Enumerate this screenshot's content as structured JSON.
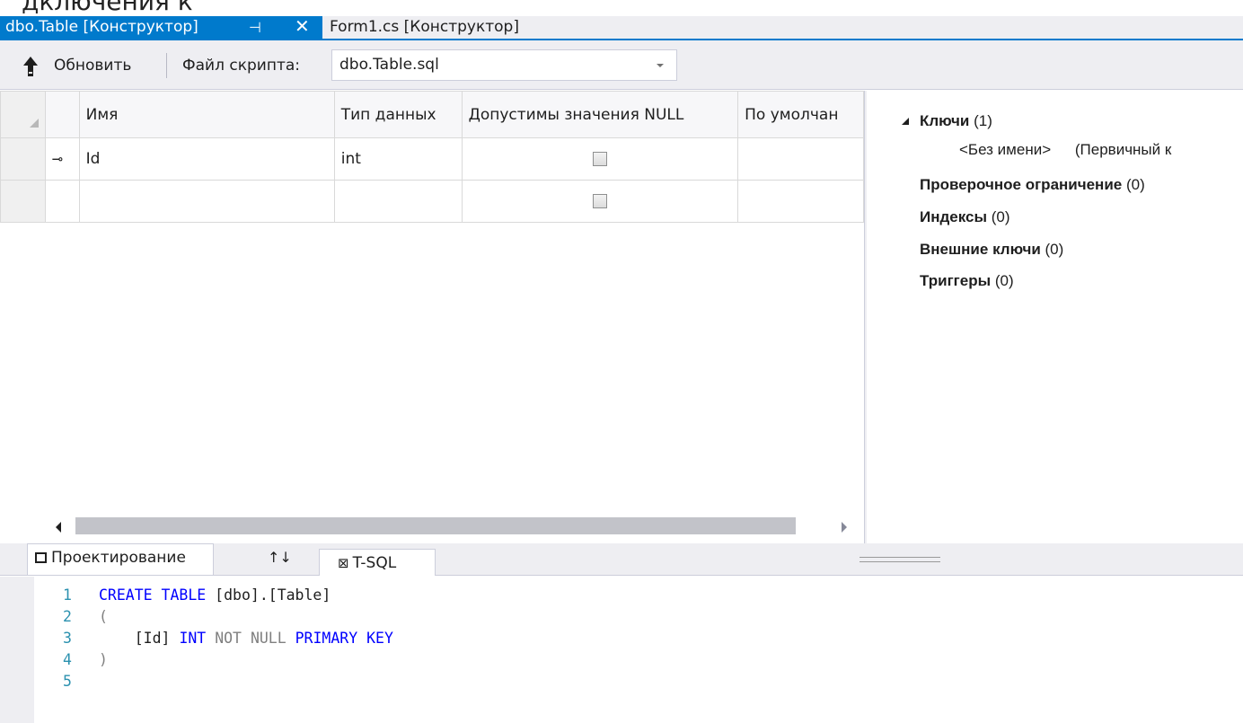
{
  "window": {
    "top_strip_text": "дключения к"
  },
  "tabs": [
    {
      "label": "dbo.Table [Конструктор]",
      "pin": "⊣",
      "close": "✕",
      "active": true
    },
    {
      "label": "Form1.cs [Конструктор]",
      "active": false
    }
  ],
  "toolbar": {
    "refresh_label": "Обновить",
    "script_label": "Файл скрипта:",
    "script_file": "dbo.Table.sql"
  },
  "grid": {
    "columns": [
      "Имя",
      "Тип данных",
      "Допустимы значения NULL",
      "По умолчан"
    ],
    "rows": [
      {
        "key": true,
        "name": "Id",
        "type": "int",
        "nullable": false,
        "default": ""
      },
      {
        "key": false,
        "name": "",
        "type": "",
        "nullable": false,
        "default": ""
      }
    ]
  },
  "properties": {
    "keys": {
      "label": "Ключи",
      "count": "(1)"
    },
    "key_item": {
      "name": "<Без имени>",
      "kind": "(Первичный к"
    },
    "check": {
      "label": "Проверочное ограничение",
      "count": "(0)"
    },
    "indexes": {
      "label": "Индексы",
      "count": "(0)"
    },
    "foreign": {
      "label": "Внешние ключи",
      "count": "(0)"
    },
    "triggers": {
      "label": "Триггеры",
      "count": "(0)"
    }
  },
  "bottom_tabs": {
    "design": "Проектирование",
    "swap": "↑↓",
    "tsql": "T-SQL"
  },
  "editor": {
    "line_numbers": [
      "1",
      "2",
      "3",
      "4",
      "5"
    ],
    "line1": {
      "kw1": "CREATE",
      "kw2": "TABLE",
      "rest": "[dbo].[Table]"
    },
    "line2": "(",
    "line3": {
      "indent": "    ",
      "id": "[Id]",
      "kw1": "INT",
      "gray1": "NOT",
      "gray2": "NULL",
      "kw2": "PRIMARY",
      "kw3": "KEY"
    },
    "line4": ")"
  },
  "colors": {
    "accent": "#007acc",
    "keyword": "#0000ff",
    "line_number": "#2b91af"
  }
}
